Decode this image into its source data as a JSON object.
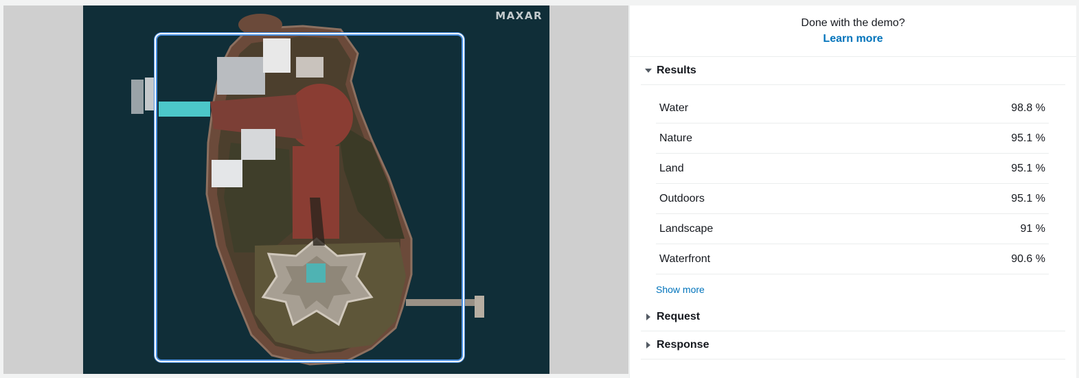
{
  "image": {
    "watermark": "MAXAR"
  },
  "demo": {
    "title": "Done with the demo?",
    "link_label": "Learn more"
  },
  "results": {
    "label": "Results",
    "items": [
      {
        "label": "Water",
        "value": "98.8 %"
      },
      {
        "label": "Nature",
        "value": "95.1 %"
      },
      {
        "label": "Land",
        "value": "95.1 %"
      },
      {
        "label": "Outdoors",
        "value": "95.1 %"
      },
      {
        "label": "Landscape",
        "value": "91 %"
      },
      {
        "label": "Waterfront",
        "value": "90.6 %"
      }
    ],
    "show_more_label": "Show more"
  },
  "request": {
    "label": "Request"
  },
  "response": {
    "label": "Response"
  },
  "colors": {
    "link": "#0073bb",
    "bbox_outline": "#4a90e2",
    "water": "#0f2b35"
  }
}
